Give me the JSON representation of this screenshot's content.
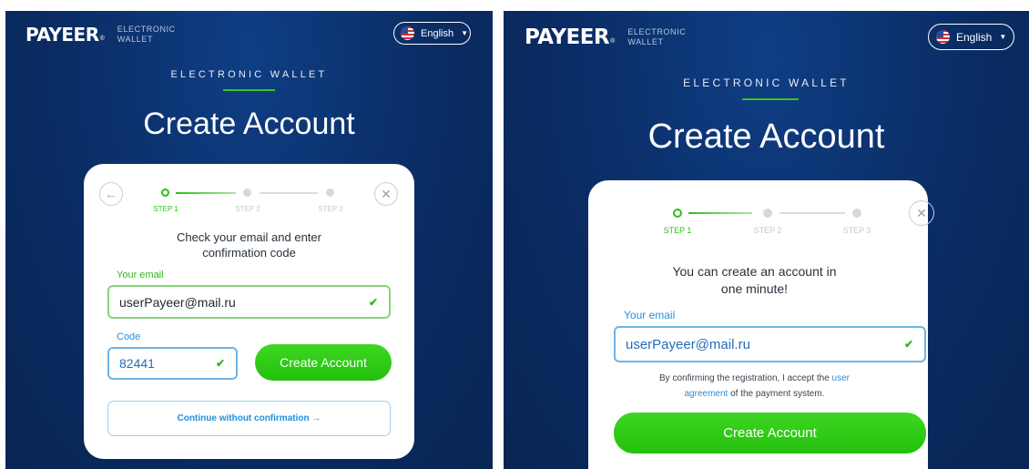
{
  "brand": {
    "logo": "PAYEER",
    "registered": "®",
    "sub_line1": "ELECTRONIC",
    "sub_line2": "WALLET"
  },
  "language": {
    "selected": "English"
  },
  "header": {
    "eyebrow": "ELECTRONIC WALLET",
    "title": "Create Account"
  },
  "steps": [
    {
      "label": "STEP 1",
      "state": "active"
    },
    {
      "label": "STEP 2",
      "state": "pending"
    },
    {
      "label": "STEP 3",
      "state": "pending"
    }
  ],
  "screen1": {
    "message_line1": "Check your email and enter",
    "message_line2": "confirmation code",
    "email_label": "Your email",
    "email_value": "userPayeer@mail.ru",
    "code_label": "Code",
    "code_value": "82441",
    "create_button": "Create Account",
    "continue_link": "Continue without confirmation →"
  },
  "screen2": {
    "message_line1": "You can create an account in",
    "message_line2": "one minute!",
    "email_label": "Your email",
    "email_value": "userPayeer@mail.ru",
    "agreement_prefix": "By confirming the registration, I accept the",
    "agreement_link1": "user",
    "agreement_link2": "agreement",
    "agreement_suffix": "of the payment system.",
    "create_button": "Create Account"
  },
  "colors": {
    "background": "#0a2c64",
    "accent_green": "#2fbf1c",
    "link_blue": "#2a8fd8"
  },
  "icons": [
    "back-arrow-icon",
    "close-icon",
    "checkmark-icon",
    "us-flag-icon",
    "chevron-down-icon"
  ]
}
